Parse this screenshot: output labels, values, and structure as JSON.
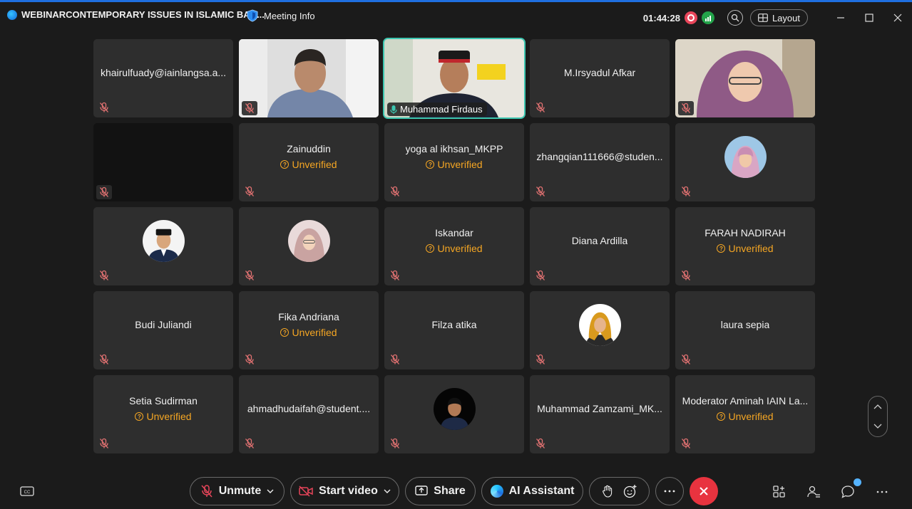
{
  "titlebar": {
    "app_title": "WEBINARCONTEMPORARY ISSUES IN ISLAMIC BAN...",
    "meeting_info": "Meeting Info",
    "timer": "01:44:28",
    "layout_label": "Layout"
  },
  "participants": [
    {
      "name": "khairulfuady@iainlangsa.a...",
      "verified": true,
      "kind": "name"
    },
    {
      "name": "",
      "verified": true,
      "kind": "video-man1"
    },
    {
      "name": "Muhammad Firdaus",
      "verified": true,
      "kind": "video-active"
    },
    {
      "name": "M.Irsyadul Afkar",
      "verified": true,
      "kind": "name"
    },
    {
      "name": "",
      "verified": true,
      "kind": "video-woman"
    },
    {
      "name": "",
      "verified": true,
      "kind": "dark"
    },
    {
      "name": "Zainuddin",
      "unverified_label": "Unverified",
      "kind": "name"
    },
    {
      "name": "yoga al ikhsan_MKPP",
      "unverified_label": "Unverified",
      "kind": "name"
    },
    {
      "name": "zhangqian111666@studen...",
      "verified": true,
      "kind": "name"
    },
    {
      "name": "",
      "kind": "avatar-hijab-blue"
    },
    {
      "name": "",
      "kind": "avatar-man-peci"
    },
    {
      "name": "",
      "kind": "avatar-hijab-pink"
    },
    {
      "name": "Iskandar",
      "unverified_label": "Unverified",
      "kind": "name"
    },
    {
      "name": "Diana Ardilla",
      "kind": "name"
    },
    {
      "name": "FARAH NADIRAH",
      "unverified_label": "Unverified",
      "kind": "name"
    },
    {
      "name": "Budi Juliandi",
      "kind": "name"
    },
    {
      "name": "Fika Andriana",
      "unverified_label": "Unverified",
      "kind": "name"
    },
    {
      "name": "Filza atika",
      "kind": "name"
    },
    {
      "name": "",
      "kind": "avatar-hijab-gold"
    },
    {
      "name": "laura sepia",
      "kind": "name"
    },
    {
      "name": "Setia Sudirman",
      "unverified_label": "Unverified",
      "kind": "name"
    },
    {
      "name": "ahmadhudaifah@student....",
      "kind": "name"
    },
    {
      "name": "",
      "kind": "avatar-man-dark"
    },
    {
      "name": "Muhammad Zamzami_MK...",
      "kind": "name"
    },
    {
      "name": "Moderator Aminah IAIN La...",
      "unverified_label": "Unverified",
      "kind": "name"
    }
  ],
  "toolbar": {
    "unmute_label": "Unmute",
    "start_video_label": "Start video",
    "share_label": "Share",
    "ai_assistant_label": "AI Assistant"
  },
  "colors": {
    "accent": "#1f6fe0",
    "unverified": "#f5a623",
    "end_call": "#e8333f",
    "active_speaker": "#3cc6b0",
    "mute_icon": "#e57373"
  }
}
